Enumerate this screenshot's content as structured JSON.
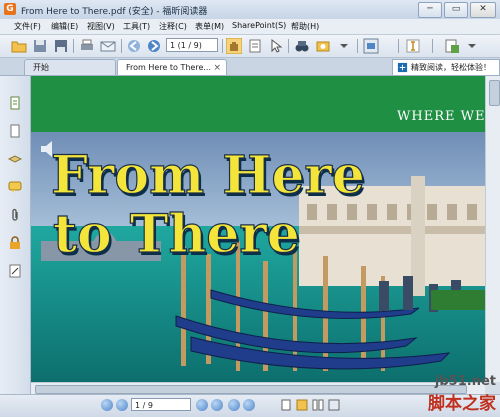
{
  "window": {
    "app_icon_letter": "G",
    "title": "From Here to There.pdf (安全) - 福昕阅读器",
    "buttons": [
      "─",
      "▭",
      "✕"
    ]
  },
  "menu": {
    "items": [
      "文件(F)",
      "编辑(E)",
      "视图(V)",
      "工具(T)",
      "注释(C)",
      "表单(M)",
      "SharePoint(S)",
      "帮助(H)"
    ]
  },
  "toolbar": {
    "page_value": "1 (1 / 9)"
  },
  "tabs": [
    {
      "label": "开始",
      "active": false
    },
    {
      "label": "From Here to There...",
      "active": true
    }
  ],
  "tab_close": "×",
  "promo": {
    "text": "精致阅读，轻松体验！"
  },
  "document": {
    "header_text": "WHERE WE",
    "title_line1": "From Here",
    "title_line2": "to There"
  },
  "statusbar": {
    "page_indicator": "1 / 9"
  },
  "watermark": {
    "site": "jb51.net",
    "brand": "脚本之家"
  },
  "colors": {
    "doc_green": "#1f8f43",
    "title_yellow": "#f3e53a",
    "accent_blue": "#4f86c7"
  }
}
